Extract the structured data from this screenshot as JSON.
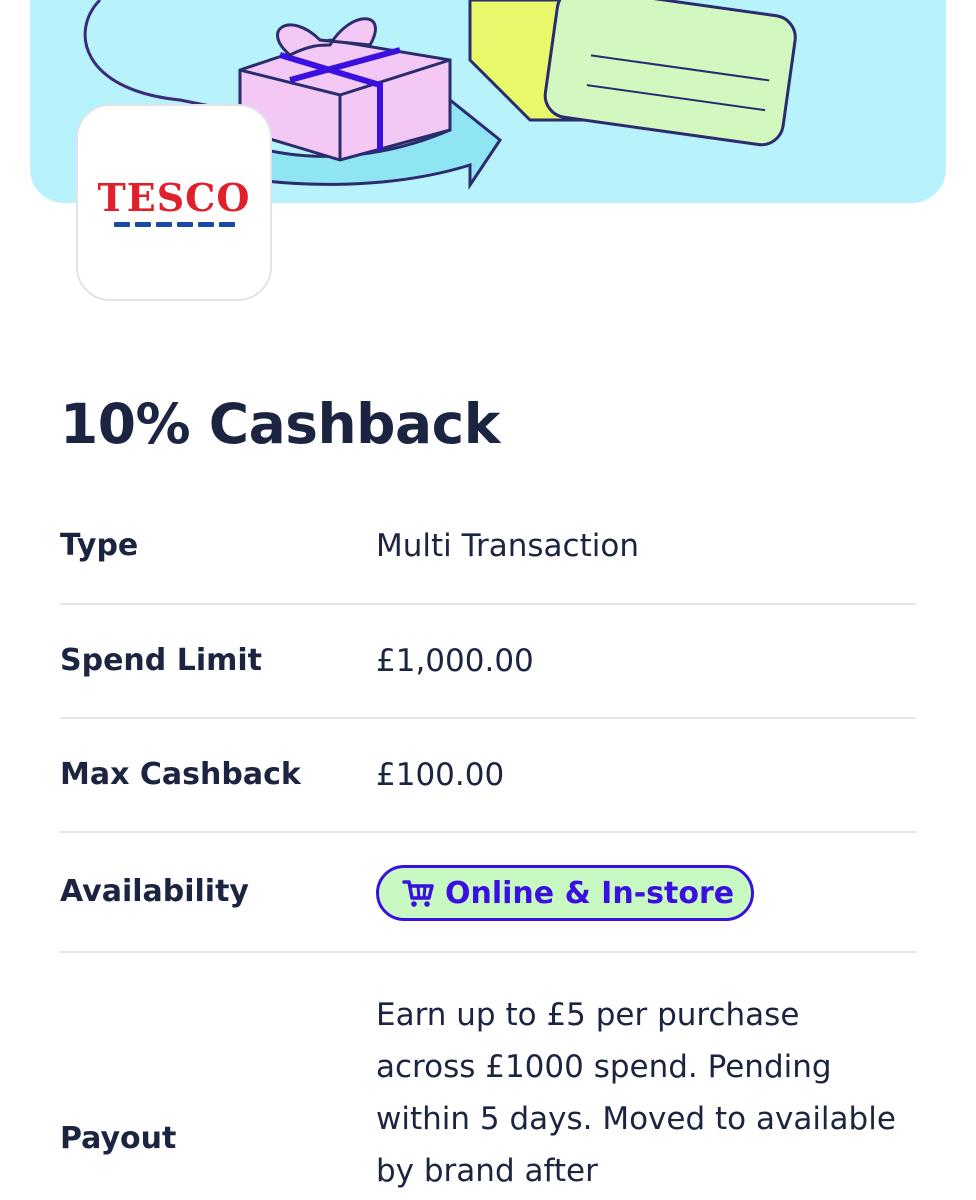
{
  "brand": {
    "logo_text": "TESCO",
    "name": "Tesco"
  },
  "offer": {
    "title": "10% Cashback",
    "details": [
      {
        "label": "Type",
        "value": "Multi Transaction"
      },
      {
        "label": "Spend Limit",
        "value": "£1,000.00"
      },
      {
        "label": "Max Cashback",
        "value": "£100.00"
      },
      {
        "label": "Availability",
        "badge": "Online & In-store"
      },
      {
        "label": "Payout",
        "value": "Earn up to £5 per purchase across £1000 spend. Pending within 5 days. Moved to available by brand after"
      }
    ]
  },
  "colors": {
    "hero_bg": "#b8f3fb",
    "text_primary": "#1b2440",
    "badge_bg": "#c9f9c3",
    "badge_accent": "#3a10e0",
    "logo_red": "#e0202b",
    "logo_blue": "#1a4aa5"
  },
  "icons": {
    "availability_badge": "shopping-cart-icon"
  }
}
